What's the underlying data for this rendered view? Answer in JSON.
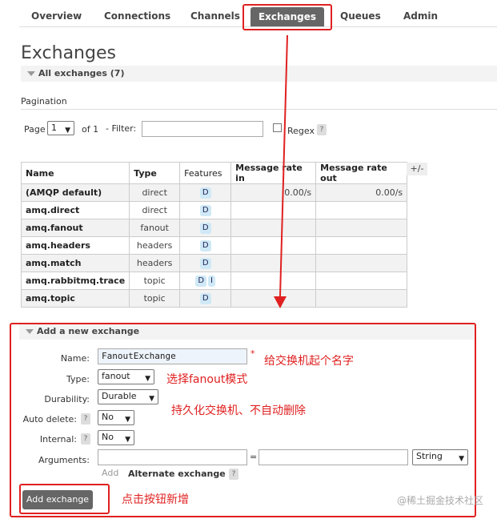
{
  "nav": {
    "overview": "Overview",
    "connections": "Connections",
    "channels": "Channels",
    "exchanges": "Exchanges",
    "queues": "Queues",
    "admin": "Admin"
  },
  "page": {
    "title": "Exchanges",
    "all_exchanges": "All exchanges (7)"
  },
  "pagination": {
    "label": "Pagination",
    "page_label": "Page",
    "page_value": "1",
    "of_label": "of 1",
    "filter_label": "- Filter:",
    "filter_value": "",
    "regex_label": "Regex",
    "help": "?"
  },
  "table": {
    "headers": [
      "Name",
      "Type",
      "Features",
      "Message rate in",
      "Message rate out"
    ],
    "plus_minus": "+/-",
    "rows": [
      {
        "name": "(AMQP default)",
        "type": "direct",
        "features": [
          "D"
        ],
        "rate_in": "0.00/s",
        "rate_out": "0.00/s"
      },
      {
        "name": "amq.direct",
        "type": "direct",
        "features": [
          "D"
        ],
        "rate_in": "",
        "rate_out": ""
      },
      {
        "name": "amq.fanout",
        "type": "fanout",
        "features": [
          "D"
        ],
        "rate_in": "",
        "rate_out": ""
      },
      {
        "name": "amq.headers",
        "type": "headers",
        "features": [
          "D"
        ],
        "rate_in": "",
        "rate_out": ""
      },
      {
        "name": "amq.match",
        "type": "headers",
        "features": [
          "D"
        ],
        "rate_in": "",
        "rate_out": ""
      },
      {
        "name": "amq.rabbitmq.trace",
        "type": "topic",
        "features": [
          "D",
          "I"
        ],
        "rate_in": "",
        "rate_out": ""
      },
      {
        "name": "amq.topic",
        "type": "topic",
        "features": [
          "D"
        ],
        "rate_in": "",
        "rate_out": ""
      }
    ]
  },
  "add_form": {
    "title": "Add a new exchange",
    "name_label": "Name:",
    "name_value": "FanoutExchange",
    "required_mark": "*",
    "type_label": "Type:",
    "type_value": "fanout",
    "durability_label": "Durability:",
    "durability_value": "Durable",
    "auto_delete_label": "Auto delete:",
    "auto_delete_value": "No",
    "internal_label": "Internal:",
    "internal_value": "No",
    "arguments_label": "Arguments:",
    "equals": "=",
    "arg_type_value": "String",
    "add_link": "Add",
    "alternate_exchange": "Alternate exchange",
    "help": "?",
    "submit": "Add exchange"
  },
  "annotations": {
    "name": "给交换机起个名字",
    "type": "选择fanout模式",
    "durability": "持久化交换机、不自动删除",
    "button": "点击按钮新增"
  },
  "watermark": "@稀土掘金技术社区",
  "colors": {
    "annotation": "#e02020",
    "active_tab": "#666666",
    "feature_badge": "#cfe9f6"
  }
}
